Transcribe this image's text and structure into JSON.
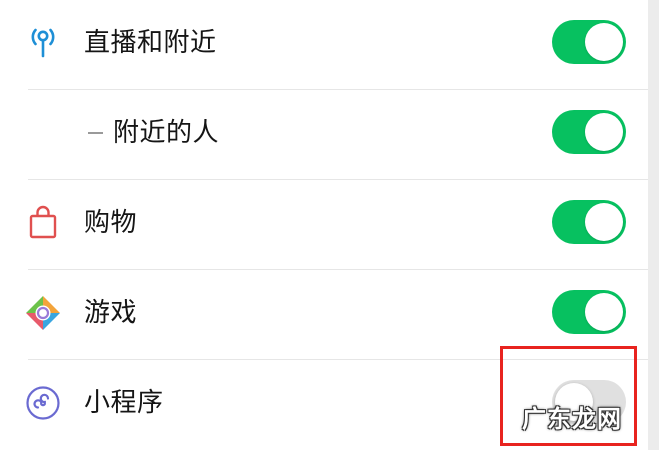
{
  "settings": {
    "items": [
      {
        "label": "直播和附近",
        "icon": "live-nearby-icon",
        "enabled": true,
        "sub": false
      },
      {
        "label": "附近的人",
        "icon": "",
        "enabled": true,
        "sub": true
      },
      {
        "label": "购物",
        "icon": "shopping-bag-icon",
        "enabled": true,
        "sub": false
      },
      {
        "label": "游戏",
        "icon": "game-diamond-icon",
        "enabled": true,
        "sub": false
      },
      {
        "label": "小程序",
        "icon": "mini-program-icon",
        "enabled": false,
        "sub": false
      }
    ]
  },
  "watermark": {
    "text": "广东龙网"
  },
  "colors": {
    "toggle_on": "#07c160",
    "toggle_off": "#e0e0e0",
    "highlight": "#e8231f",
    "live_icon": "#1e8fd6",
    "shop_icon": "#e0504f",
    "mini_program_icon": "#6a6ad1"
  }
}
